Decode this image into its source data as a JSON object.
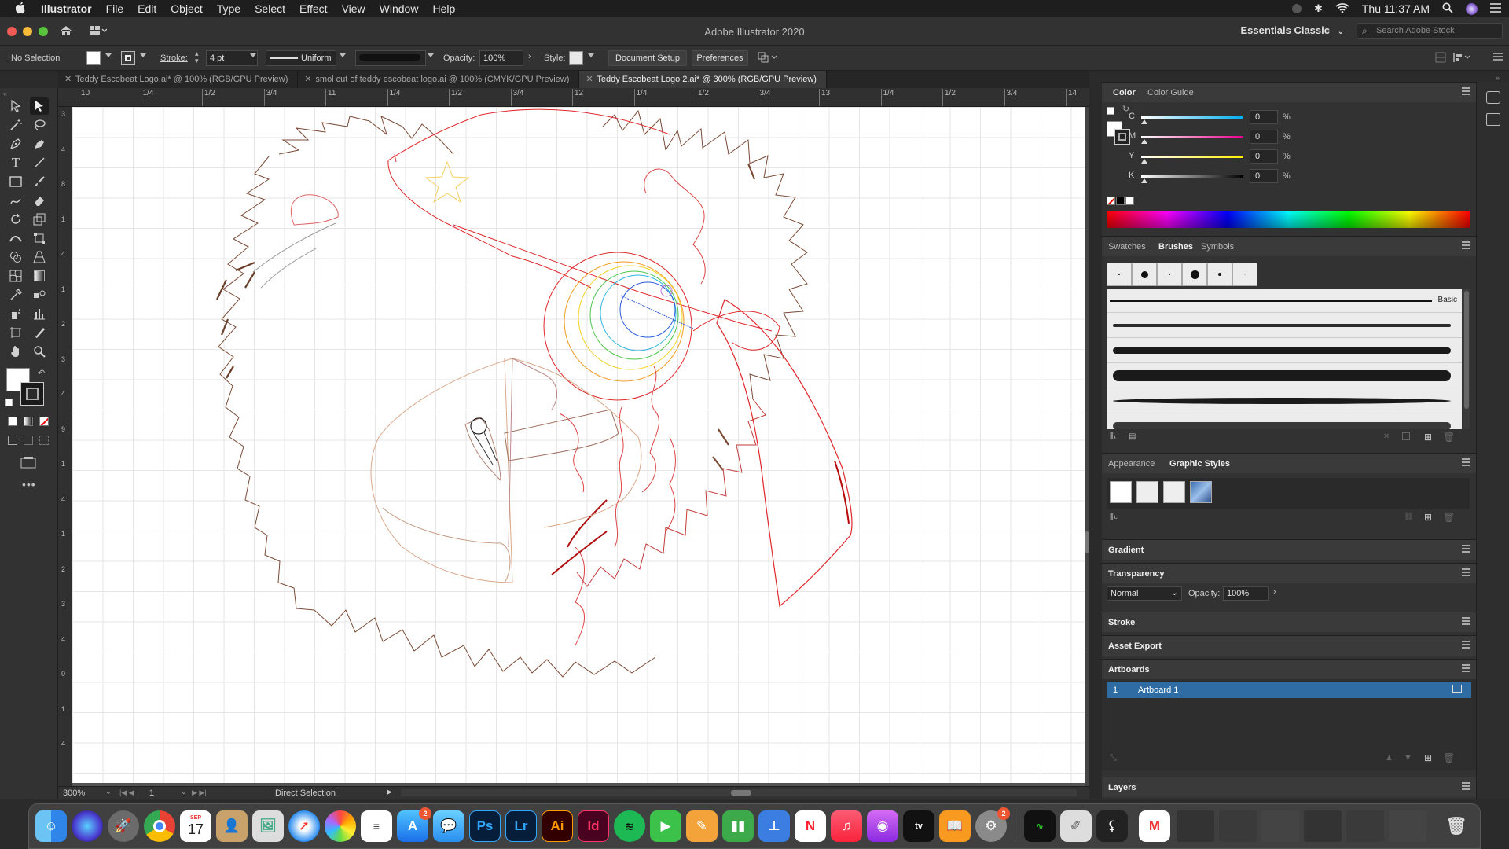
{
  "menubar": {
    "items": [
      "Illustrator",
      "File",
      "Edit",
      "Object",
      "Type",
      "Select",
      "Effect",
      "View",
      "Window",
      "Help"
    ],
    "clock": "Thu 11:37 AM"
  },
  "titlebar": {
    "title": "Adobe Illustrator 2020",
    "workspace": "Essentials Classic",
    "stock_search_placeholder": "Search Adobe Stock"
  },
  "controlbar": {
    "selection": "No Selection",
    "stroke_label": "Stroke:",
    "stroke_weight": "4 pt",
    "profile": "Uniform",
    "opacity_label": "Opacity:",
    "opacity_value": "100%",
    "style_label": "Style:",
    "document_setup": "Document Setup",
    "preferences": "Preferences"
  },
  "tabs": [
    {
      "label": "Teddy Escobeat Logo.ai* @ 100% (RGB/GPU Preview)"
    },
    {
      "label": "smol cut of teddy escobeat logo.ai @ 100% (CMYK/GPU Preview)"
    },
    {
      "label": "Teddy Escobeat Logo 2.ai* @ 300% (RGB/GPU Preview)"
    }
  ],
  "ruler": {
    "top": [
      "10",
      "1/4",
      "1/2",
      "3/4",
      "11",
      "1/4",
      "1/2",
      "3/4",
      "12",
      "1/4",
      "1/2",
      "3/4",
      "13",
      "1/4",
      "1/2",
      "3/4",
      "14"
    ],
    "left": [
      "3",
      "4",
      "8",
      "1",
      "4",
      "1",
      "2",
      "3",
      "4",
      "9",
      "1",
      "4",
      "1",
      "2",
      "3",
      "4",
      "0",
      "1",
      "4"
    ]
  },
  "status": {
    "zoom": "300%",
    "artboard_num": "1",
    "tool": "Direct Selection"
  },
  "color_panel": {
    "tabs": [
      "Color",
      "Color Guide"
    ],
    "channels": [
      {
        "name": "C",
        "value": "0"
      },
      {
        "name": "M",
        "value": "0"
      },
      {
        "name": "Y",
        "value": "0"
      },
      {
        "name": "K",
        "value": "0"
      }
    ],
    "pct": "%"
  },
  "brushes_panel": {
    "tabs": [
      "Swatches",
      "Brushes",
      "Symbols"
    ],
    "basic_label": "Basic"
  },
  "styles_panel": {
    "tabs": [
      "Appearance",
      "Graphic Styles"
    ]
  },
  "collapsed_panels": {
    "gradient": "Gradient",
    "transparency": "Transparency",
    "stroke": "Stroke",
    "asset_export": "Asset Export",
    "artboards": "Artboards",
    "layers": "Layers"
  },
  "transparency": {
    "mode": "Normal",
    "opacity_label": "Opacity:",
    "opacity_value": "100%"
  },
  "artboards": {
    "rows": [
      {
        "num": "1",
        "name": "Artboard 1"
      }
    ]
  },
  "dock": {
    "calendar_day": "17",
    "calendar_month": "SEP",
    "badge_appstore": "2",
    "badge_prefs": "2",
    "labels": [
      "Ps",
      "Lr",
      "Ai",
      "Id"
    ]
  },
  "colors": {
    "accent": "#2f6ca3",
    "artwork_red": "#e0282c",
    "artwork_brown": "#7a4a35"
  }
}
